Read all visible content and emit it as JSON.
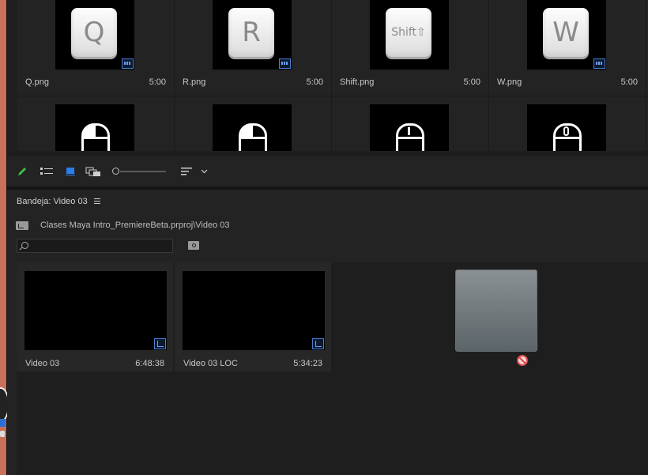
{
  "project_panel_top": {
    "items": [
      {
        "name": "Q.png",
        "duration": "5:00",
        "key_label": "Q"
      },
      {
        "name": "R.png",
        "duration": "5:00",
        "key_label": "R"
      },
      {
        "name": "Shift.png",
        "duration": "5:00",
        "key_label": "Shift⇧"
      },
      {
        "name": "W.png",
        "duration": "5:00",
        "key_label": "W"
      }
    ],
    "second_row": [
      "mouse-left",
      "mouse-left",
      "mouse-plain",
      "mouse-middle"
    ]
  },
  "toolbar": {
    "icons": [
      "pencil-icon",
      "list-view-icon",
      "icon-view-icon",
      "freeform-view-icon",
      "zoom-slider",
      "sort-icon",
      "chevron-down-icon"
    ]
  },
  "bin": {
    "title": "Bandeja: Video 03",
    "path": "Clases Maya Intro_PremiereBeta.prproj\\Video 03",
    "search": {
      "value": "",
      "placeholder": ""
    },
    "clips": [
      {
        "name": "Video 03",
        "duration": "6:48:38"
      },
      {
        "name": "Video 03 LOC",
        "duration": "5:34:23"
      }
    ]
  },
  "colors": {
    "accent": "#2b7de9",
    "panel": "#232323",
    "no_drop": "#d94c4c"
  }
}
